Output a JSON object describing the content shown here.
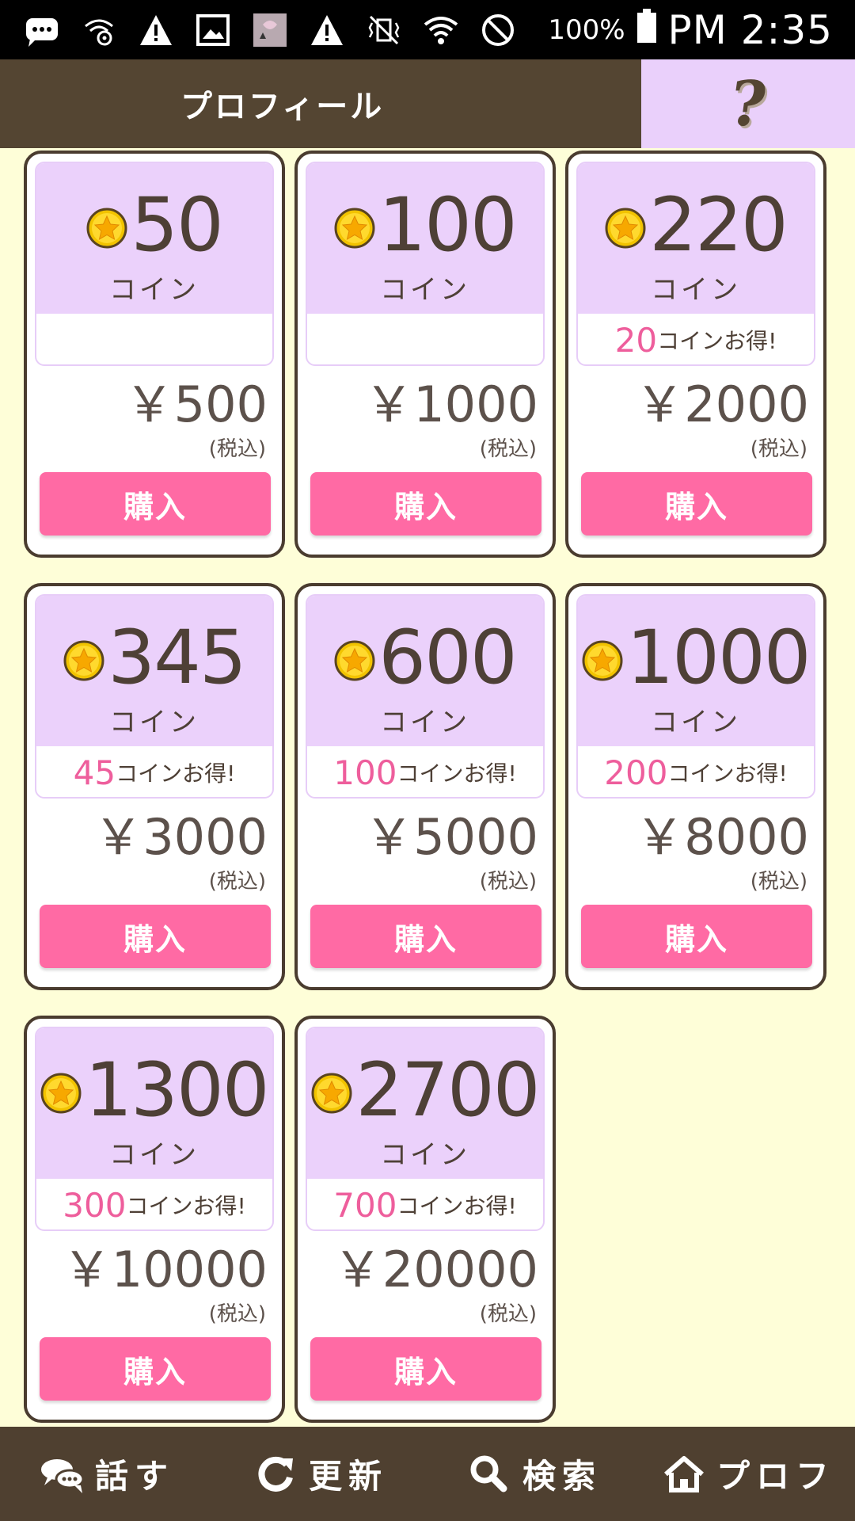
{
  "status_bar": {
    "icons": [
      "message-icon",
      "wifi-settings-icon",
      "warning-icon",
      "image-icon",
      "app-thumbnail-icon",
      "warning-icon",
      "vibrate-off-icon",
      "wifi-icon",
      "block-icon"
    ],
    "battery": "100%",
    "time": "PM 2:35"
  },
  "header": {
    "title": "プロフィール",
    "help_label": "?"
  },
  "products": [
    {
      "coins": "50",
      "unit": "コイン",
      "bonus": "",
      "bonus_suffix": "",
      "price": "￥500",
      "tax": "(税込)",
      "buy_label": "購入"
    },
    {
      "coins": "100",
      "unit": "コイン",
      "bonus": "",
      "bonus_suffix": "",
      "price": "￥1000",
      "tax": "(税込)",
      "buy_label": "購入"
    },
    {
      "coins": "220",
      "unit": "コイン",
      "bonus": "20",
      "bonus_suffix": "コインお得!",
      "price": "￥2000",
      "tax": "(税込)",
      "buy_label": "購入"
    },
    {
      "coins": "345",
      "unit": "コイン",
      "bonus": "45",
      "bonus_suffix": "コインお得!",
      "price": "￥3000",
      "tax": "(税込)",
      "buy_label": "購入"
    },
    {
      "coins": "600",
      "unit": "コイン",
      "bonus": "100",
      "bonus_suffix": "コインお得!",
      "price": "￥5000",
      "tax": "(税込)",
      "buy_label": "購入"
    },
    {
      "coins": "1000",
      "unit": "コイン",
      "bonus": "200",
      "bonus_suffix": "コインお得!",
      "price": "￥8000",
      "tax": "(税込)",
      "buy_label": "購入"
    },
    {
      "coins": "1300",
      "unit": "コイン",
      "bonus": "300",
      "bonus_suffix": "コインお得!",
      "price": "￥10000",
      "tax": "(税込)",
      "buy_label": "購入"
    },
    {
      "coins": "2700",
      "unit": "コイン",
      "bonus": "700",
      "bonus_suffix": "コインお得!",
      "price": "￥20000",
      "tax": "(税込)",
      "buy_label": "購入"
    }
  ],
  "bottom_nav": {
    "items": [
      {
        "label": "話す",
        "icon": "chat-bubbles-icon"
      },
      {
        "label": "更新",
        "icon": "refresh-icon"
      },
      {
        "label": "検索",
        "icon": "search-icon"
      },
      {
        "label": "プロフ",
        "icon": "home-icon"
      }
    ]
  },
  "colors": {
    "background": "#fefed8",
    "header": "#544532",
    "help_bg": "#ead0fb",
    "coin_area": "#ebd1fb",
    "bonus_number": "#ee5e9c",
    "buy_button": "#ff6aa4",
    "card_border": "#4a3c2f"
  }
}
